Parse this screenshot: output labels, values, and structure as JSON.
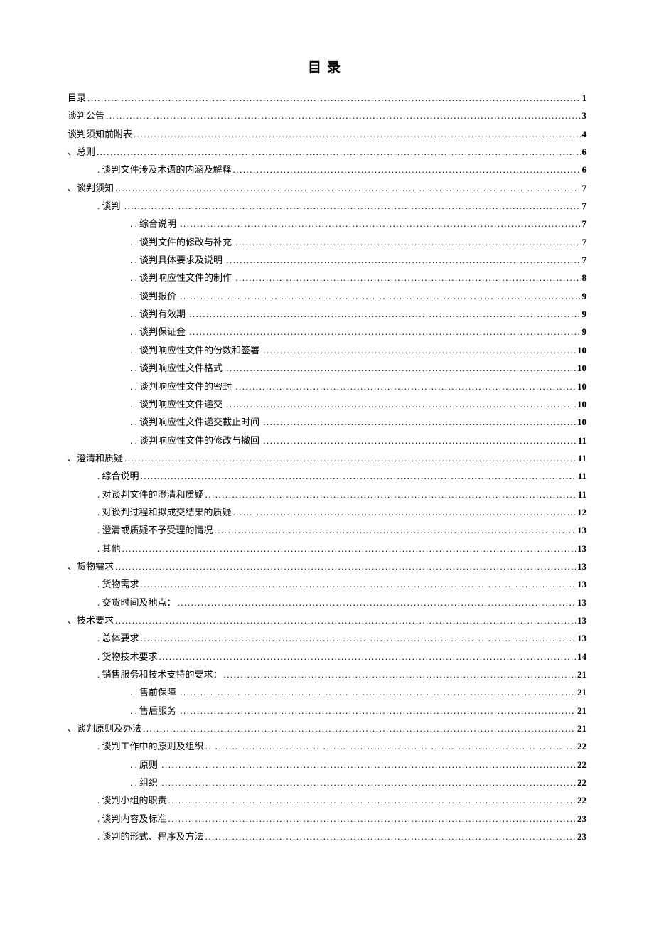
{
  "title": "目录",
  "entries": [
    {
      "level": 0,
      "prefix": "",
      "label": "目录",
      "page": "1",
      "trail": false
    },
    {
      "level": 0,
      "prefix": "",
      "label": "谈判公告",
      "page": "3",
      "trail": false
    },
    {
      "level": 0,
      "prefix": "",
      "label": "谈判须知前附表",
      "page": "4",
      "trail": false
    },
    {
      "level": 0,
      "prefix": "comma",
      "label": "总则",
      "page": "6",
      "trail": false
    },
    {
      "level": 1,
      "prefix": "dot",
      "label": "谈判文件涉及术语的内涵及解释",
      "page": "6",
      "trail": false
    },
    {
      "level": 0,
      "prefix": "comma",
      "label": "谈判须知",
      "page": "7",
      "trail": false
    },
    {
      "level": 1,
      "prefix": "dot",
      "label": "谈判",
      "page": "7",
      "trail": true
    },
    {
      "level": 2,
      "prefix": "dotdot",
      "label": "综合说明",
      "page": "7",
      "trail": true
    },
    {
      "level": 2,
      "prefix": "dotdot",
      "label": "谈判文件的修改与补充",
      "page": "7",
      "trail": true
    },
    {
      "level": 2,
      "prefix": "dotdot",
      "label": "谈判具体要求及说明",
      "page": "7",
      "trail": true
    },
    {
      "level": 2,
      "prefix": "dotdot",
      "label": "谈判响应性文件的制作",
      "page": "8",
      "trail": true
    },
    {
      "level": 2,
      "prefix": "dotdot",
      "label": "谈判报价",
      "page": "9",
      "trail": true
    },
    {
      "level": 2,
      "prefix": "dotdot",
      "label": "谈判有效期",
      "page": "9",
      "trail": true
    },
    {
      "level": 2,
      "prefix": "dotdot",
      "label": "谈判保证金",
      "page": "9",
      "trail": true
    },
    {
      "level": 2,
      "prefix": "dotdot",
      "label": "谈判响应性文件的份数和签署",
      "page": "10",
      "trail": true
    },
    {
      "level": 2,
      "prefix": "dotdot",
      "label": "谈判响应性文件格式",
      "page": "10",
      "trail": true
    },
    {
      "level": 2,
      "prefix": "dotdot",
      "label": "谈判响应性文件的密封",
      "page": "10",
      "trail": true
    },
    {
      "level": 2,
      "prefix": "dotdot",
      "label": "谈判响应性文件递交",
      "page": "10",
      "trail": true
    },
    {
      "level": 2,
      "prefix": "dotdot",
      "label": "谈判响应性文件递交截止时间",
      "page": "10",
      "trail": true
    },
    {
      "level": 2,
      "prefix": "dotdot",
      "label": "谈判响应性文件的修改与撤回",
      "page": "11",
      "trail": true
    },
    {
      "level": 0,
      "prefix": "comma",
      "label": "澄清和质疑",
      "page": "11",
      "trail": false
    },
    {
      "level": 1,
      "prefix": "dot",
      "label": "综合说明",
      "page": "11",
      "trail": false
    },
    {
      "level": 1,
      "prefix": "dot",
      "label": "对谈判文件的澄清和质疑",
      "page": "11",
      "trail": false
    },
    {
      "level": 1,
      "prefix": "dot",
      "label": "对谈判过程和拟成交结果的质疑",
      "page": "12",
      "trail": false
    },
    {
      "level": 1,
      "prefix": "dot",
      "label": "澄清或质疑不予受理的情况",
      "page": "13",
      "trail": false
    },
    {
      "level": 1,
      "prefix": "dot",
      "label": "其他",
      "page": "13",
      "trail": false
    },
    {
      "level": 0,
      "prefix": "comma",
      "label": "货物需求",
      "page": "13",
      "trail": false
    },
    {
      "level": 1,
      "prefix": "dot",
      "label": "货物需求",
      "page": "13",
      "trail": false
    },
    {
      "level": 1,
      "prefix": "dot",
      "label": "交货时间及地点：",
      "page": "13",
      "trail": false
    },
    {
      "level": 0,
      "prefix": "comma",
      "label": "技术要求",
      "page": "13",
      "trail": false
    },
    {
      "level": 1,
      "prefix": "dot",
      "label": "总体要求",
      "page": "13",
      "trail": false
    },
    {
      "level": 1,
      "prefix": "dot",
      "label": "货物技术要求",
      "page": "14",
      "trail": false
    },
    {
      "level": 1,
      "prefix": "dot",
      "label": "销售服务和技术支持的要求：",
      "page": "21",
      "trail": false
    },
    {
      "level": 2,
      "prefix": "dotdot",
      "label": "售前保障",
      "page": "21",
      "trail": true
    },
    {
      "level": 2,
      "prefix": "dotdot",
      "label": "售后服务",
      "page": "21",
      "trail": true
    },
    {
      "level": 0,
      "prefix": "comma",
      "label": "谈判原则及办法",
      "page": "21",
      "trail": false
    },
    {
      "level": 1,
      "prefix": "dot",
      "label": "谈判工作中的原则及组织",
      "page": "22",
      "trail": false
    },
    {
      "level": 2,
      "prefix": "dotdot",
      "label": "原则",
      "page": "22",
      "trail": true
    },
    {
      "level": 2,
      "prefix": "dotdot",
      "label": "组织",
      "page": "22",
      "trail": true
    },
    {
      "level": 1,
      "prefix": "dot",
      "label": "谈判小组的职责",
      "page": "22",
      "trail": false
    },
    {
      "level": 1,
      "prefix": "dot",
      "label": "谈判内容及标准",
      "page": "23",
      "trail": false
    },
    {
      "level": 1,
      "prefix": "dot",
      "label": "谈判的形式、程序及方法",
      "page": "23",
      "trail": false
    }
  ]
}
